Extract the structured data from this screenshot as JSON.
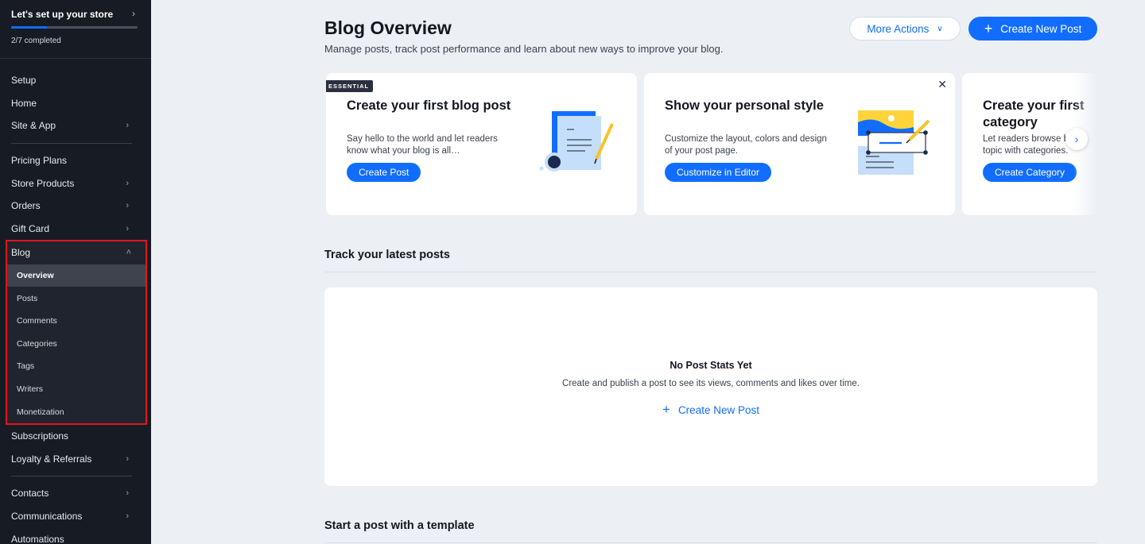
{
  "sidebar": {
    "setup": {
      "title": "Let's set up your store",
      "status": "2/7 completed",
      "progress_completed": 2,
      "progress_total": 7
    },
    "group1": [
      {
        "label": "Setup",
        "has_chevron": false
      },
      {
        "label": "Home",
        "has_chevron": false
      },
      {
        "label": "Site & App",
        "has_chevron": true
      }
    ],
    "group2": [
      {
        "label": "Pricing Plans",
        "has_chevron": false
      },
      {
        "label": "Store Products",
        "has_chevron": true
      },
      {
        "label": "Orders",
        "has_chevron": true
      },
      {
        "label": "Gift Card",
        "has_chevron": true
      }
    ],
    "blog": {
      "label": "Blog",
      "expanded": true,
      "subitems": [
        {
          "label": "Overview",
          "active": true
        },
        {
          "label": "Posts",
          "active": false
        },
        {
          "label": "Comments",
          "active": false
        },
        {
          "label": "Categories",
          "active": false
        },
        {
          "label": "Tags",
          "active": false
        },
        {
          "label": "Writers",
          "active": false
        },
        {
          "label": "Monetization",
          "active": false
        }
      ]
    },
    "group3": [
      {
        "label": "Subscriptions",
        "has_chevron": false
      },
      {
        "label": "Loyalty & Referrals",
        "has_chevron": true
      }
    ],
    "group4": [
      {
        "label": "Contacts",
        "has_chevron": true
      },
      {
        "label": "Communications",
        "has_chevron": true
      },
      {
        "label": "Automations",
        "has_chevron": false
      }
    ]
  },
  "header": {
    "title": "Blog Overview",
    "subtitle": "Manage posts, track post performance and learn about new ways to improve your blog.",
    "more_actions_label": "More Actions",
    "create_new_post_label": "Create New Post"
  },
  "cards": [
    {
      "badge": "ESSENTIAL",
      "title": "Create your first blog post",
      "description": "Say hello to the world and let readers know what your blog is all…",
      "button": "Create Post"
    },
    {
      "title": "Show your personal style",
      "description": "Customize the layout, colors and design of your post page.",
      "button": "Customize in Editor"
    },
    {
      "title": "Create your first category",
      "description": "Let readers browse by topic with categories.",
      "button": "Create Category"
    }
  ],
  "track_section": {
    "title": "Track your latest posts",
    "empty_title": "No Post Stats Yet",
    "empty_description": "Create and publish a post to see its views, comments and likes over time.",
    "empty_action": "Create New Post"
  },
  "template_section": {
    "title": "Start a post with a template"
  },
  "colors": {
    "accent": "#116DFF",
    "sidebar_bg": "#171B24",
    "page_bg": "#ECEFF4",
    "highlight_border": "#E3141E",
    "badge_bg": "#2B2F3F"
  }
}
